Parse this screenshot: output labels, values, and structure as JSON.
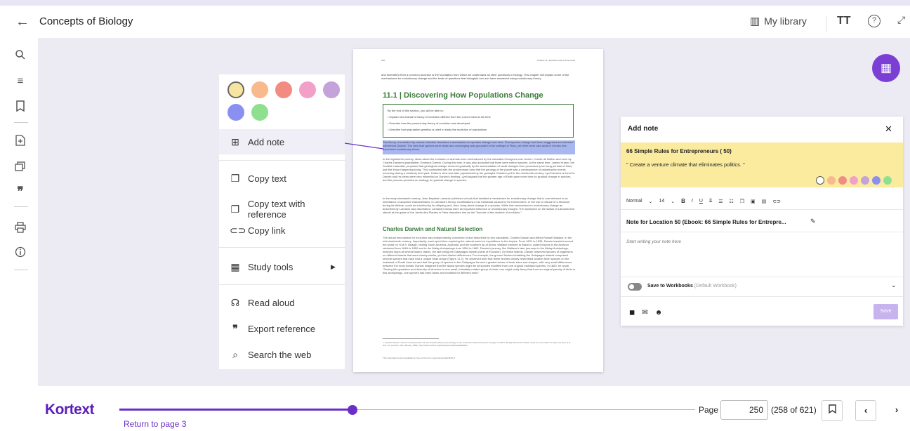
{
  "header": {
    "back_icon": "arrow-left-icon",
    "book_title": "Concepts of Biology",
    "my_library": "My library",
    "text_size": "TT",
    "help": "?",
    "expand_icon": "expand-icon"
  },
  "sidebar": {
    "icons": [
      "search-icon",
      "contents-icon",
      "bookmark-icon",
      "add-note-icon",
      "highlights-icon",
      "quote-icon",
      "print-icon",
      "info-icon"
    ]
  },
  "book_page": {
    "header_left": "300",
    "header_right": "Chapter 11 | Evolution and Its Processes",
    "intro": "and diversified from a common ancestor is the foundation from which we understand all other questions in biology. This chapter will explain some of the mechanisms for evolutionary change and the kinds of questions that biologists can and have answered using evolutionary theory.",
    "section_title": "11.1 | Discovering How Populations Change",
    "objectives_intro": "By the end of this section, you will be able to:",
    "objectives": [
      "Explain how Darwin's theory of evolution differed from the current view at the time",
      "Describe how the present-day theory of evolution was developed",
      "Describe how population genetics is used to study the evolution of populations"
    ],
    "highlight": "The theory of evolution by natural selection describes a mechanism for species change over time. That species change had been suggested and debated well before Darwin. The view that species were static and unchanging was grounded in the writings of Plato, yet there were also ancient Greeks that expressed evolutionary ideas.",
    "para1": "In the eighteenth century, ideas about the evolution of animals were reintroduced by the naturalist Georges-Louis Leclerc, Comte de Buffon and even by Charles Darwin's grandfather, Erasmus Darwin. During this time, it was also accepted that there were extinct species. At the same time, James Hutton, the Scottish naturalist, proposed that geological change occurred gradually by the accumulation of small changes from processes (over long periods of time) just like those happening today. This contrasted with the predominant view that the geology of the planet was a consequence of catastrophic events occurring during a relatively brief past. Hutton's view was later popularized by the geologist Charles Lyell in the nineteenth century. Lyell became a friend to Darwin and his ideas were very influential on Darwin's thinking. Lyell argued that the greater age of Earth gave more time for gradual change in species, and the process provided an analogy for gradual change in species.",
    "para2": "In the early nineteenth century, Jean-Baptiste Lamarck published a book that detailed a mechanism for evolutionary change that is now referred to as inheritance of acquired characteristics. In Lamarck's theory, modifications in an individual caused by its environment, or the use or disuse of a structure during its lifetime, could be inherited by its offspring and, thus, bring about change in a species. While this mechanism for evolutionary change as described by Lamarck was discredited, Lamarck's ideas were an important influence on evolutionary thought. The inscription on the statue of Lamarck that stands at the gates of the Jardin des Plantes in Paris describes him as the \"founder of the doctrine of evolution.\"",
    "subsection_title": "Charles Darwin and Natural Selection",
    "para3": "The actual mechanism for evolution was independently conceived of and described by two naturalists, Charles Darwin and Alfred Russell Wallace, in the mid-nineteenth century. Importantly, each spent time exploring the natural world on expeditions to the tropics. From 1831 to 1836, Darwin traveled around the world on H.M.S. Beagle, visiting South America, Australia, and the southern tip of Africa. Wallace traveled to Brazil to collect insects in the Amazon rainforest from 1848 to 1852 and to the Malay Archipelago from 1854 to 1862. Darwin's journey, like Wallace's later journeys in the Malay Archipelago, included stops at several island chains, the last being the Galápagos Islands (west of Ecuador). On these islands, Darwin observed species of organisms on different islands that were clearly similar, yet had distinct differences. For example, the ground finches inhabiting the Galápagos Islands comprised several species that each had a unique beak shape (Figure 11.2). He observed both that these finches closely resembled another finch species on the mainland of South America and that the group of species in the Galápagos formed a graded series of beak sizes and shapes, with very small differences between the most similar. Darwin imagined that the island species might be all species modified from one original mainland species. In 1860, he wrote, \"Seeing this gradation and diversity of structure in one small, intimately related group of birds, one might really fancy that from an original paucity of birds in this archipelago, one species had been taken and modified for different ends.\"",
    "footnote": "1. Charles Darwin, Journal of Researches into the Natural History and Geology of the Countries Visited during the Voyage of H.M.S. Beagle Round the World, under the Command of Capt. Fitz Roy, R.N, 2nd. ed. (London: John Murray, 1860), http://www.archive.org/details/journalofresea00darw.",
    "license": "This OpenStax book is available for free at http://cnx.org/content/col11487/1.5"
  },
  "context_menu": {
    "colors": [
      "#f6e4a0",
      "#f8b98d",
      "#f28b82",
      "#f3a0c9",
      "#c3a3d9",
      "#8a8ff2",
      "#8ee08e"
    ],
    "items": [
      {
        "icon": "add-note-icon",
        "label": "Add note"
      },
      {
        "icon": "copy-icon",
        "label": "Copy text"
      },
      {
        "icon": "copy-icon",
        "label": "Copy text with reference"
      },
      {
        "icon": "link-icon",
        "label": "Copy link"
      },
      {
        "icon": "study-tools-icon",
        "label": "Study tools"
      },
      {
        "icon": "read-aloud-icon",
        "label": "Read aloud"
      },
      {
        "icon": "quote-icon",
        "label": "Export reference"
      },
      {
        "icon": "search-icon",
        "label": "Search the web"
      }
    ]
  },
  "note_panel": {
    "title": "Add note",
    "close": "✕",
    "book_title": "66 Simple Rules for Entrepreneurs ( 50)",
    "quote": "\" Create a venture climate that eliminates politics. \"",
    "colors": [
      "#ffffff",
      "#f8b98d",
      "#f28b82",
      "#f3a0c9",
      "#c3a3d9",
      "#8a8ff2",
      "#8ee08e"
    ],
    "toolbar": {
      "style": "Normal",
      "size": "14"
    },
    "note_title": "Note for Location 50 (Ebook: 66 Simple Rules for Entrepre...",
    "placeholder": "Start writing your note here",
    "save_to": "Save to Workbooks",
    "workbook": "(Default Workbook)",
    "save": "Save"
  },
  "footer": {
    "logo": "Kortext",
    "return": "Return to page 3",
    "page_label": "Page",
    "page_value": "250",
    "page_of": "(258 of 621)",
    "progress_fraction": 0.405
  },
  "accent_color": "#6b2fc8"
}
